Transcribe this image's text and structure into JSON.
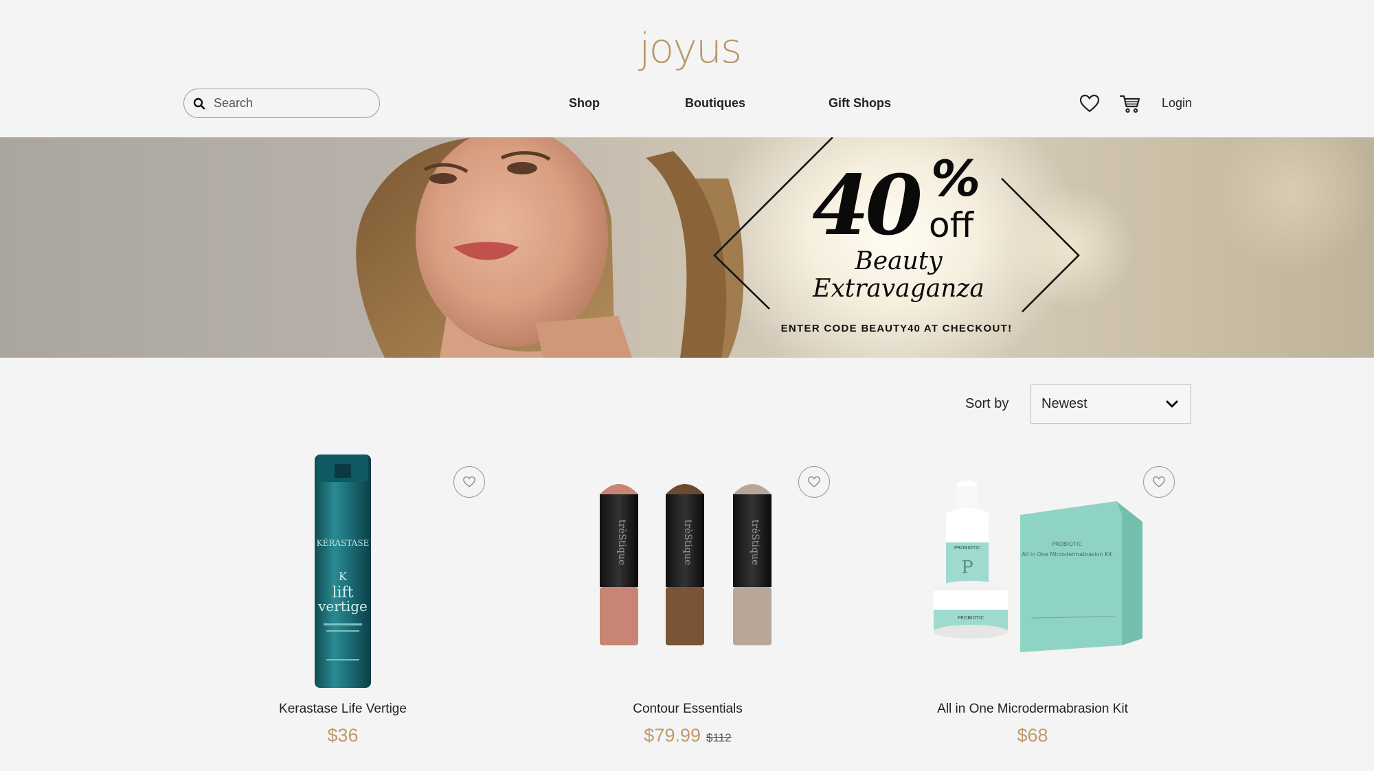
{
  "header": {
    "logo": "joyus",
    "search_placeholder": "Search",
    "nav": [
      "Shop",
      "Boutiques",
      "Gift Shops"
    ],
    "login": "Login",
    "icons": [
      "search-icon",
      "heart-icon",
      "cart-icon"
    ]
  },
  "banner": {
    "discount": "40",
    "percent": "%",
    "off": "off",
    "line1": "Beauty",
    "line2": "Extravaganza",
    "code_prefix": "ENTER CODE",
    "code": "BEAUTY40",
    "code_suffix": "AT CHECKOUT!"
  },
  "sort": {
    "label": "Sort by",
    "selected": "Newest"
  },
  "products": [
    {
      "name": "Kerastase Life Vertige",
      "price": "$36",
      "was": ""
    },
    {
      "name": "Contour Essentials",
      "price": "$79.99",
      "was": "$112"
    },
    {
      "name": "All in One Microdermabrasion Kit",
      "price": "$68",
      "was": ""
    }
  ],
  "colors": {
    "accent": "#c19a6b",
    "logo": "#b89968",
    "background": "#f4f4f4",
    "bottle": "#1f6e76",
    "box": "#8fd3c4"
  }
}
